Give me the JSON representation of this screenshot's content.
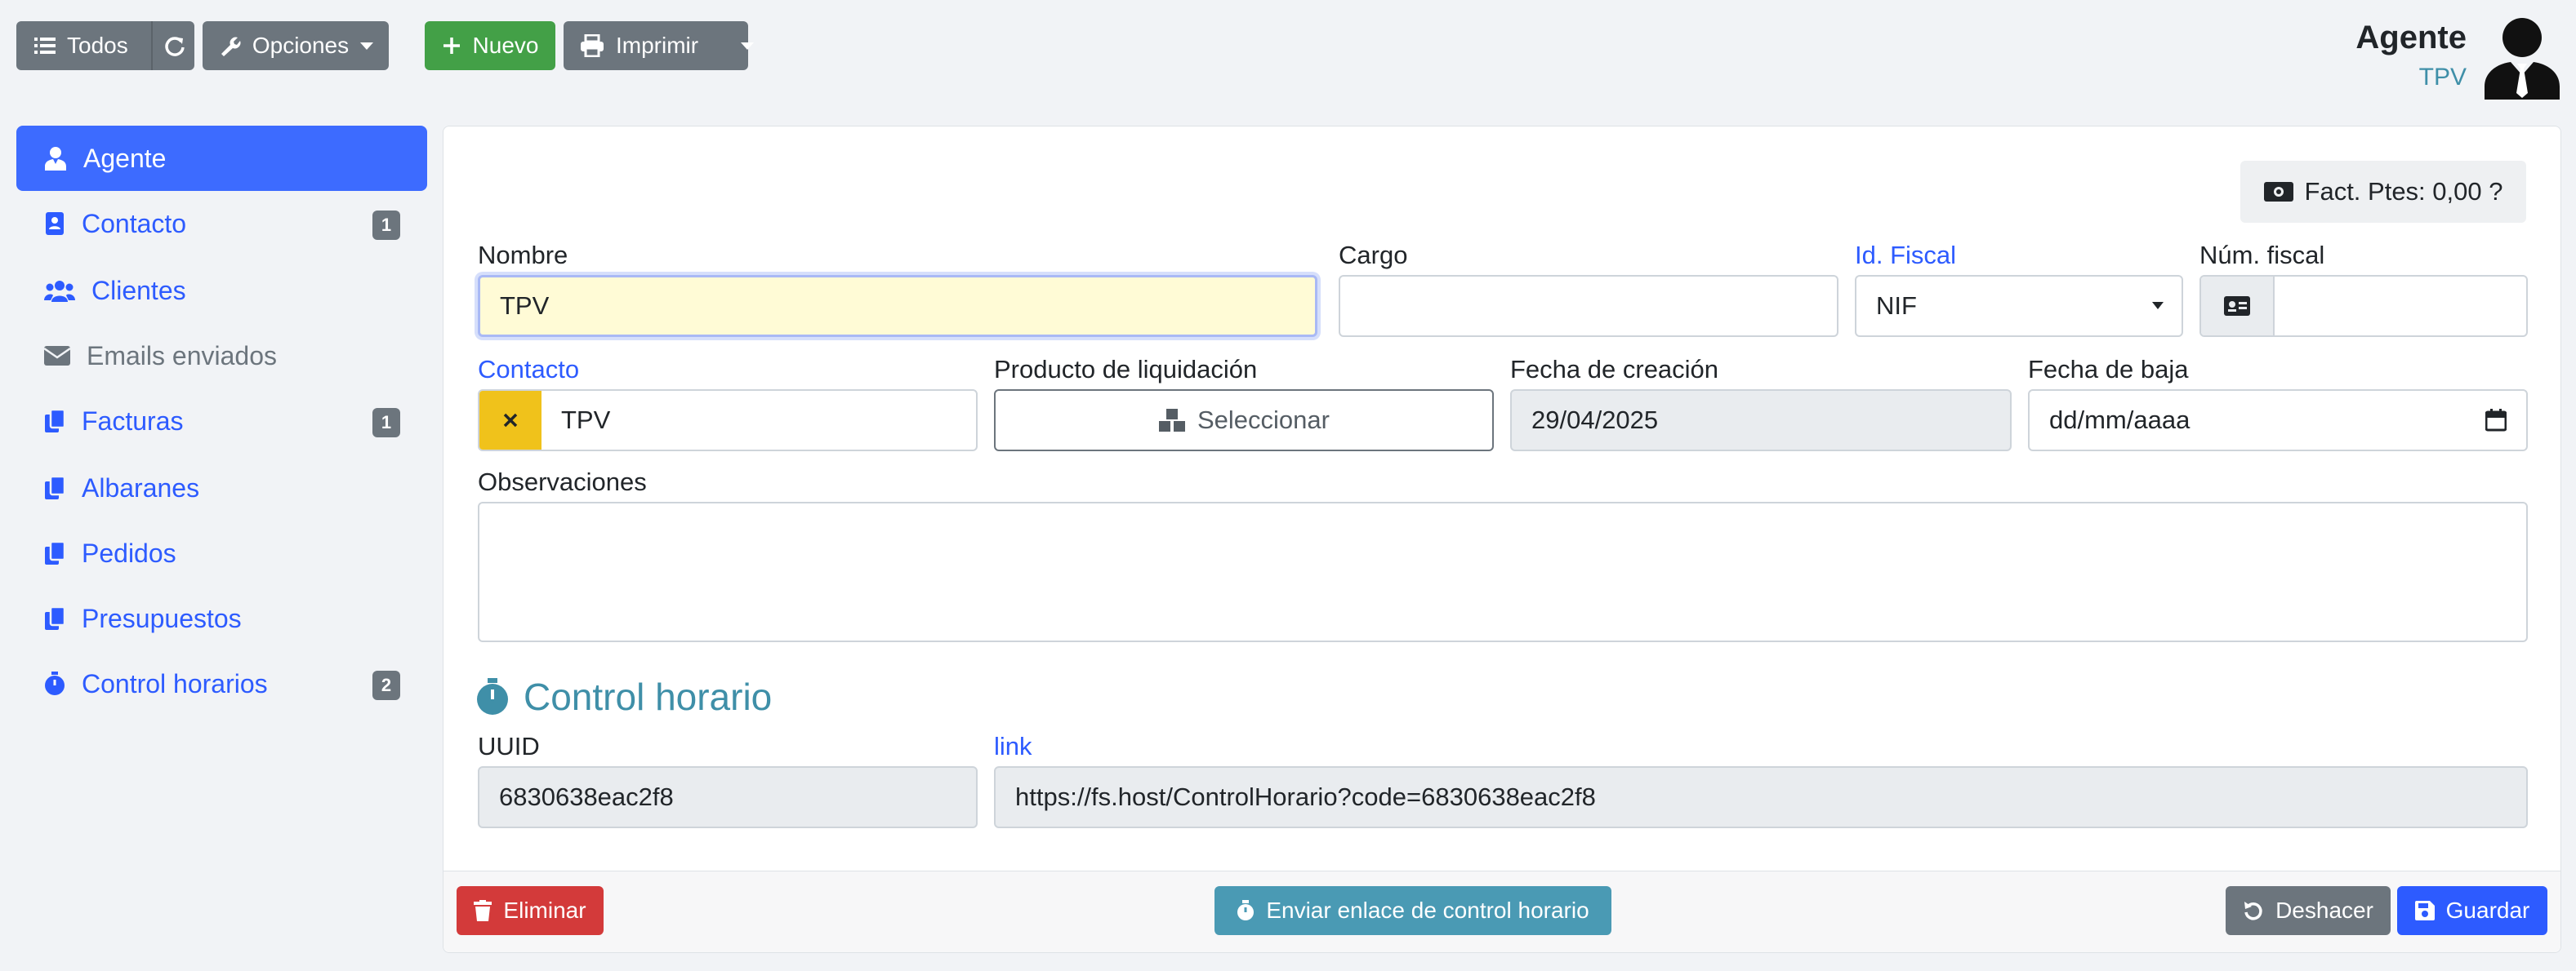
{
  "toolbar": {
    "all_label": "Todos",
    "options_label": "Opciones",
    "new_label": "Nuevo",
    "print_label": "Imprimir"
  },
  "header": {
    "title": "Agente",
    "subtitle": "TPV"
  },
  "sidebar": {
    "items": [
      {
        "label": "Agente",
        "icon": "user-tie-icon"
      },
      {
        "label": "Contacto",
        "badge": "1",
        "icon": "address-book-icon"
      },
      {
        "label": "Clientes",
        "icon": "users-icon"
      },
      {
        "label": "Emails enviados",
        "icon": "envelope-icon"
      },
      {
        "label": "Facturas",
        "badge": "1",
        "icon": "copy-icon"
      },
      {
        "label": "Albaranes",
        "icon": "copy-icon"
      },
      {
        "label": "Pedidos",
        "icon": "copy-icon"
      },
      {
        "label": "Presupuestos",
        "icon": "copy-icon"
      },
      {
        "label": "Control horarios",
        "badge": "2",
        "icon": "stopwatch-icon"
      }
    ]
  },
  "form": {
    "pending_invoices": "Fact. Ptes: 0,00 ?",
    "name_label": "Nombre",
    "name_value": "TPV",
    "position_label": "Cargo",
    "position_value": "",
    "fiscal_id_label": "Id. Fiscal",
    "fiscal_id_value": "NIF",
    "fiscal_num_label": "Núm. fiscal",
    "fiscal_num_value": "",
    "contact_label": "Contacto",
    "contact_value": "TPV",
    "product_label": "Producto de liquidación",
    "product_button": "Seleccionar",
    "created_label": "Fecha de creación",
    "created_value": "29/04/2025",
    "leave_label": "Fecha de baja",
    "leave_placeholder": "dd/mm/aaaa",
    "notes_label": "Observaciones",
    "notes_value": ""
  },
  "time_control": {
    "title": "Control horario",
    "uuid_label": "UUID",
    "uuid_value": "6830638eac2f8",
    "link_label": "link",
    "link_value": "https://fs.host/ControlHorario?code=6830638eac2f8"
  },
  "footer": {
    "delete_label": "Eliminar",
    "send_label": "Enviar enlace de control horario",
    "undo_label": "Deshacer",
    "save_label": "Guardar"
  },
  "colors": {
    "primary": "#2d5bff",
    "active_sidebar": "#3d6bff",
    "success": "#43a047",
    "danger": "#d33a3a",
    "info": "#4a9ab4",
    "secondary": "#6c757d",
    "warning": "#f0c21b"
  }
}
